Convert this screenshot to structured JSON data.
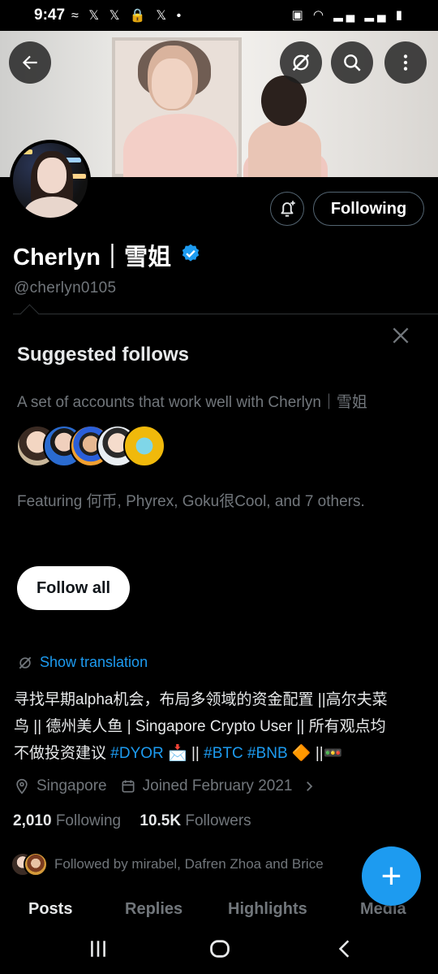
{
  "status_bar": {
    "time": "9:47",
    "left_icons": "≈ 𝕏 𝕏 🔒 𝕏 •",
    "right_icons": "▣ ◠ ▂▄ ▂▄ ▮"
  },
  "banner": {
    "back_icon": "arrow-left-icon",
    "grok_icon": "grok-icon",
    "search_icon": "search-icon",
    "more_icon": "more-vertical-icon"
  },
  "profile": {
    "name": "Cherlyn｜雪姐",
    "handle": "@cherlyn0105",
    "following_button": "Following",
    "notify_icon": "bell-plus-icon",
    "verified_color": "#1d9bf0"
  },
  "suggested": {
    "title": "Suggested follows",
    "description": "A set of accounts that work well with Cherlyn｜雪姐",
    "featuring": "Featuring 何币, Phyrex, Goku很Cool, and 7 others.",
    "follow_all": "Follow all"
  },
  "translation": {
    "label": "Show translation"
  },
  "bio": {
    "line1": "寻找早期alpha机会，布局多领域的资金配置 ||高尔夫菜",
    "line2": "鸟 || 德州美人鱼 | Singapore Crypto User || 所有观点均",
    "line3_prefix": "不做投资建议 ",
    "tag1": "#DYOR",
    "mid1": " 📩 || ",
    "tag2": "#BTC",
    "sp": " ",
    "tag3": "#BNB",
    "suffix": " 🔶 ||🚥"
  },
  "meta": {
    "location": "Singapore",
    "joined": "Joined February 2021"
  },
  "stats": {
    "following_count": "2,010",
    "following_label": "Following",
    "followers_count": "10.5K",
    "followers_label": "Followers"
  },
  "followed_by": "Followed by mirabel, Dafren Zhoa and Brice",
  "tabs": [
    "Posts",
    "Replies",
    "Highlights",
    "Media"
  ],
  "fab": "+",
  "colors": {
    "accent": "#1d9bf0",
    "background": "#000000",
    "muted": "#71767b"
  }
}
